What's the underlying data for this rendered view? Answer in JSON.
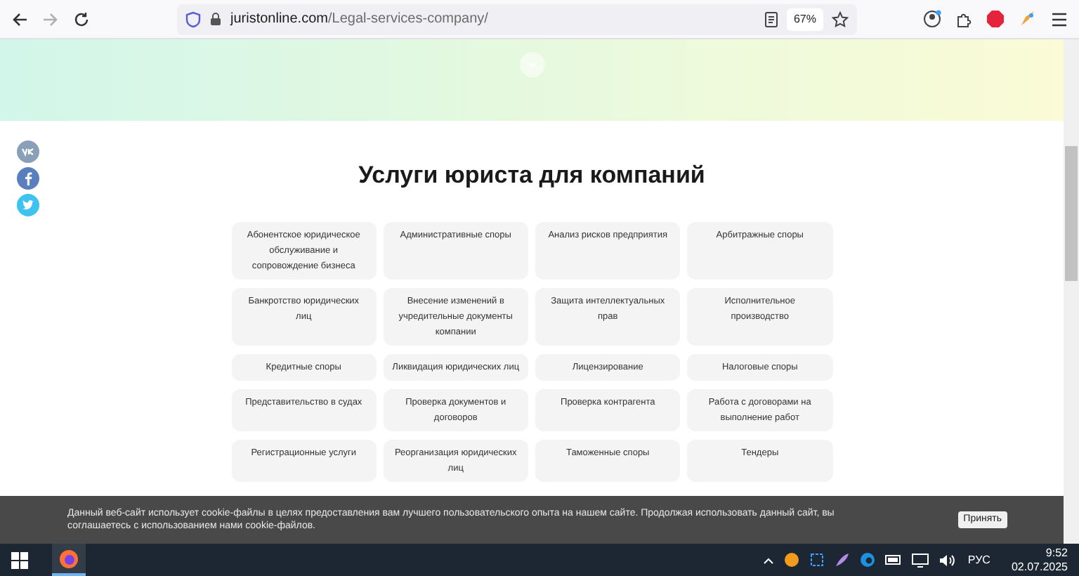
{
  "browser": {
    "url_domain": "juristonline.com",
    "url_path": "/Legal-services-company/",
    "zoom": "67%",
    "forward_disabled": true
  },
  "page": {
    "title": "Услуги юриста для компаний",
    "services": [
      "Абонентское юридическое обслуживание и сопровождение бизнеса",
      "Административные споры",
      "Анализ рисков предприятия",
      "Арбитражные споры",
      "Банкротство юридических лиц",
      "Внесение изменений в учредительные документы компании",
      "Защита интеллектуальных прав",
      "Исполнительное производство",
      "Кредитные споры",
      "Ликвидация юридических лиц",
      "Лицензирование",
      "Налоговые споры",
      "Представительство в судах",
      "Проверка документов и договоров",
      "Проверка контрагента",
      "Работа с договорами на выполнение работ",
      "Регистрационные услуги",
      "Реорганизация юридических лиц",
      "Таможенные споры",
      "Тендеры"
    ]
  },
  "cookie_banner": {
    "text": "Данный веб-сайт использует cookie-файлы в целях предоставления вам лучшего пользовательского опыта на нашем сайте. Продолжая использовать данный сайт, вы соглашаетесь с использованием нами cookie-файлов.",
    "button": "Принять"
  },
  "taskbar": {
    "language": "РУС",
    "time": "9:52",
    "date": "02.07.2025"
  }
}
